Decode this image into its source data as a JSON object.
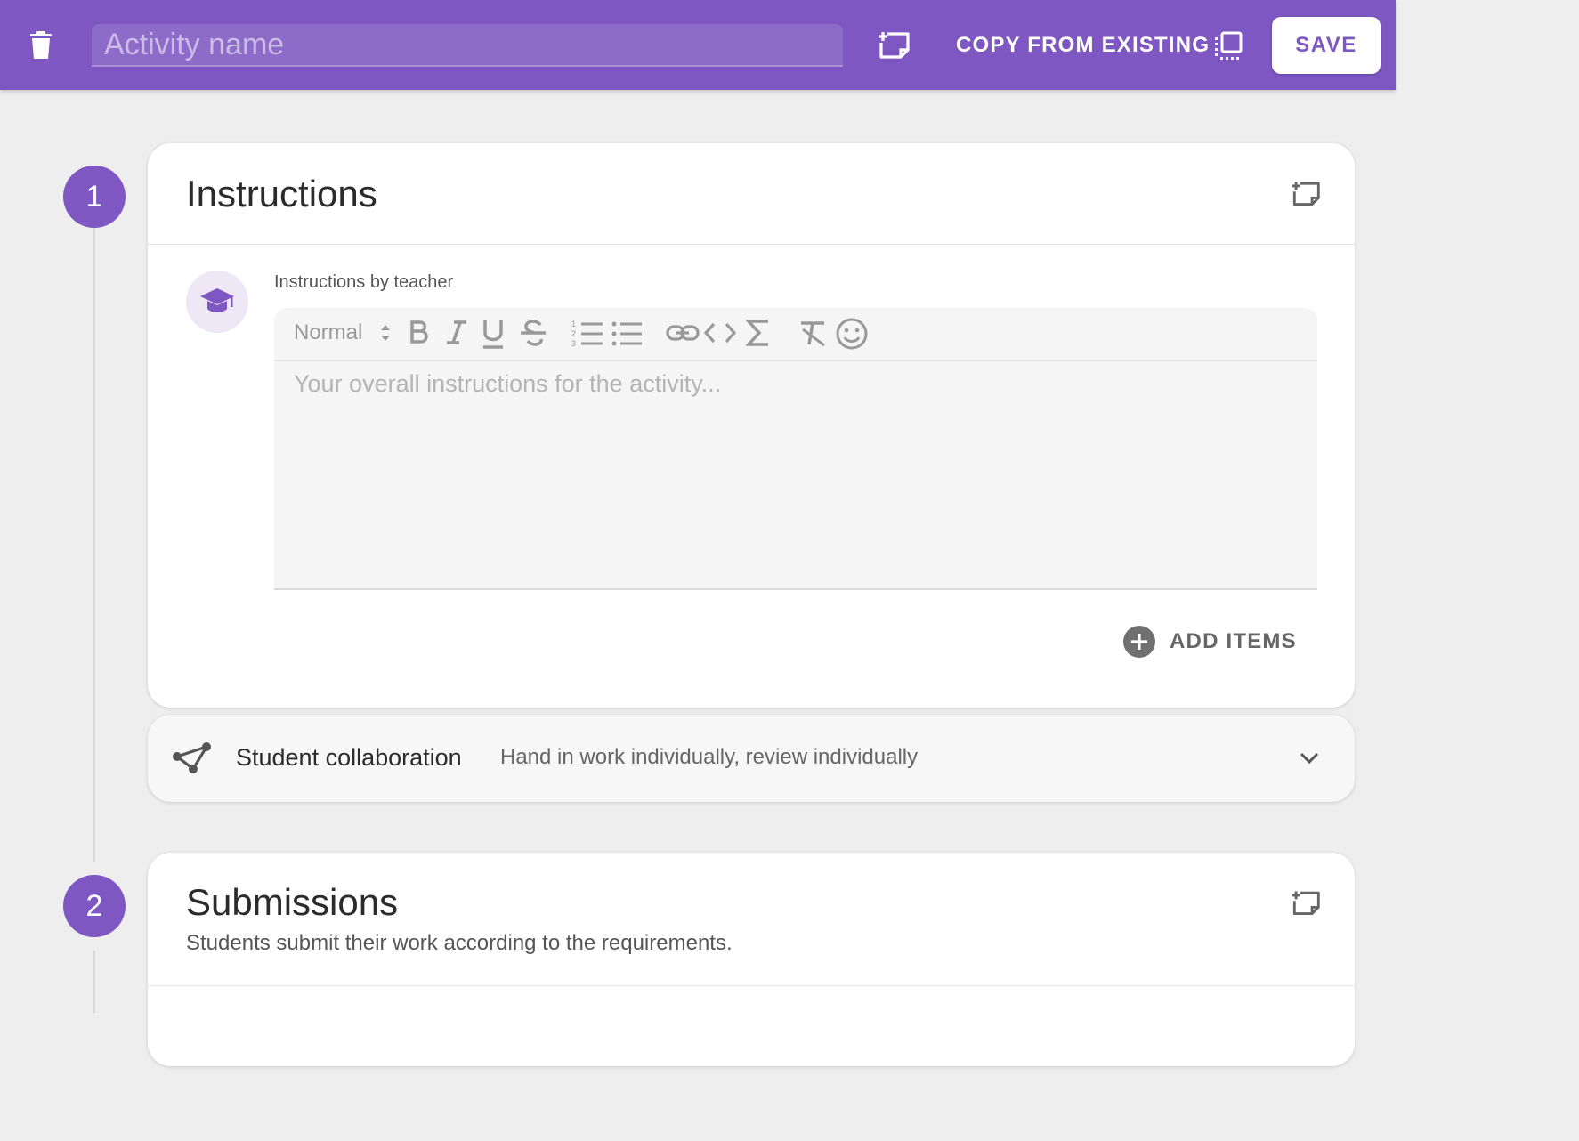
{
  "header": {
    "activity_name_placeholder": "Activity name",
    "activity_name_value": "",
    "copy_from_existing_label": "COPY FROM EXISTING",
    "save_label": "SAVE",
    "accent_color": "#7e57c2"
  },
  "sections": [
    {
      "step": "1",
      "title": "Instructions",
      "teacher_label": "Instructions by teacher",
      "editor": {
        "format_label": "Normal",
        "placeholder": "Your overall instructions for the activity...",
        "toolbar_icons": [
          "bold-icon",
          "italic-icon",
          "underline-icon",
          "strikethrough-icon",
          "ordered-list-icon",
          "bullet-list-icon",
          "link-icon",
          "code-icon",
          "formula-icon",
          "clear-format-icon",
          "emoji-icon"
        ]
      },
      "add_items_label": "ADD ITEMS"
    },
    {
      "step": "2",
      "title": "Submissions",
      "description": "Students submit their work according to the requirements."
    }
  ],
  "collaboration": {
    "title": "Student collaboration",
    "value": "Hand in work individually, review individually"
  }
}
